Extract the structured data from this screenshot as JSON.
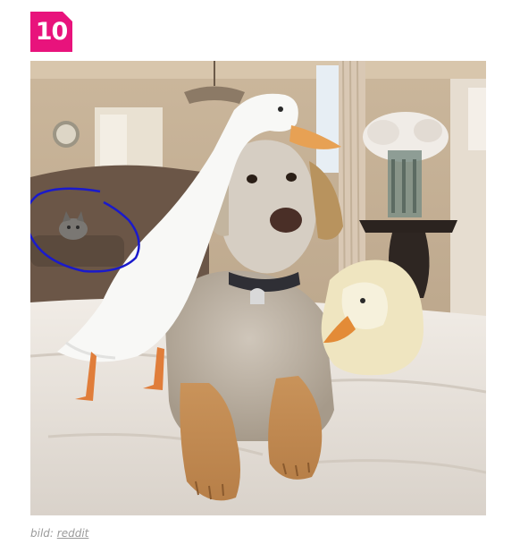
{
  "badge": {
    "number": "10",
    "color": "#e8137c"
  },
  "photo": {
    "alt": "",
    "annotation_color": "#1a1acc"
  },
  "caption": {
    "prefix": "bild:",
    "source_link": "reddit"
  }
}
